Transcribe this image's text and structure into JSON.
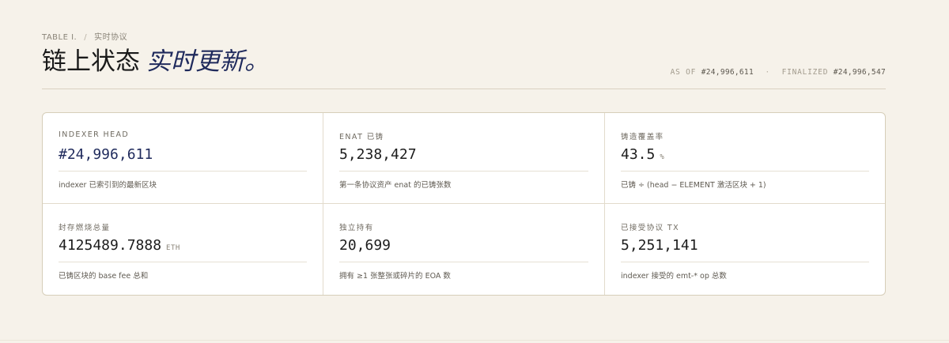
{
  "header": {
    "eyebrow_table": "TABLE I.",
    "eyebrow_sep": "/",
    "eyebrow_section": "实时协议",
    "title_plain": "链上状态",
    "title_accent": "实时更新。",
    "asof_label": "AS OF",
    "asof_value": "#24,996,611",
    "asof_dot": "·",
    "finalized_label": "FINALIZED",
    "finalized_value": "#24,996,547"
  },
  "stats": [
    {
      "label": "INDEXER HEAD",
      "value": "#24,996,611",
      "unit": "",
      "desc": "indexer 已索引到的最新区块"
    },
    {
      "label": "ENAT 已铸",
      "value": "5,238,427",
      "unit": "",
      "desc": "第一条协议资产 enat 的已铸张数"
    },
    {
      "label": "铸造覆盖率",
      "value": "43.5",
      "unit": "%",
      "desc": "已铸 ÷ (head − ELEMENT 激活区块 + 1)"
    },
    {
      "label": "封存燃烧总量",
      "value": "4125489.7888",
      "unit": "ETH",
      "desc": "已铸区块的 base fee 总和"
    },
    {
      "label": "独立持有",
      "value": "20,699",
      "unit": "",
      "desc": "拥有 ≥1 张整张或碎片的 EOA 数"
    },
    {
      "label": "已接受协议 TX",
      "value": "5,251,141",
      "unit": "",
      "desc": "indexer 接受的 emt-* op 总数"
    }
  ]
}
